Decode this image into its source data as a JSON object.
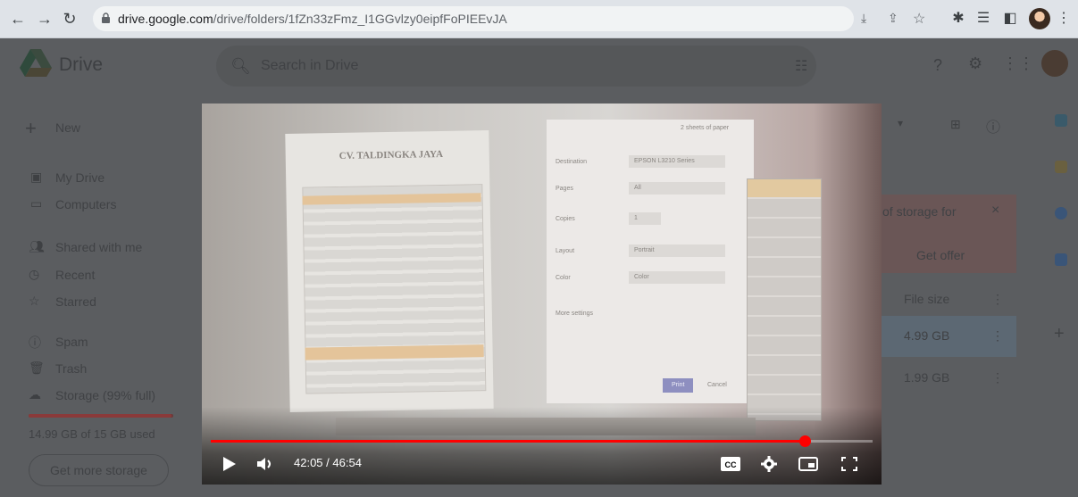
{
  "browser": {
    "url_host": "drive.google.com",
    "url_path": "/drive/folders/1fZn33zFmz_I1GGvlzy0eipfFoPIEEvJA"
  },
  "drive": {
    "brand": "Drive",
    "search_placeholder": "Search in Drive",
    "new_label": "New",
    "nav": [
      {
        "label": "My Drive",
        "icon": "drive-icon"
      },
      {
        "label": "Computers",
        "icon": "computer-icon"
      },
      {
        "label": "Shared with me",
        "icon": "people-icon"
      },
      {
        "label": "Recent",
        "icon": "clock-icon"
      },
      {
        "label": "Starred",
        "icon": "star-icon"
      },
      {
        "label": "Spam",
        "icon": "spam-icon"
      },
      {
        "label": "Trash",
        "icon": "trash-icon"
      },
      {
        "label": "Storage (99% full)",
        "icon": "cloud-icon"
      }
    ],
    "storage_used_text": "14.99 GB of 15 GB used",
    "storage_fraction": 0.99,
    "get_more_storage": "Get more storage",
    "alert_text": "of storage for",
    "alert_close": "×",
    "get_offer": "Get offer",
    "file_size_header": "File size",
    "file_sizes": [
      "4.99 GB",
      "1.99 GB"
    ]
  },
  "video": {
    "time_current": "42:05",
    "time_total": "46:54",
    "time_separator": " / ",
    "progress_fraction": 0.897,
    "frame_doc": {
      "title": "CV. TALDINGKA JAYA",
      "dialog_header": "2 sheets of paper",
      "dialog_labels": [
        "Destination",
        "Pages",
        "Copies",
        "Layout",
        "Color",
        "More settings"
      ],
      "dialog_values": [
        "EPSON L3210 Series",
        "All",
        "1",
        "Portrait",
        "Color"
      ],
      "print_btn": "Print",
      "cancel_btn": "Cancel"
    }
  }
}
